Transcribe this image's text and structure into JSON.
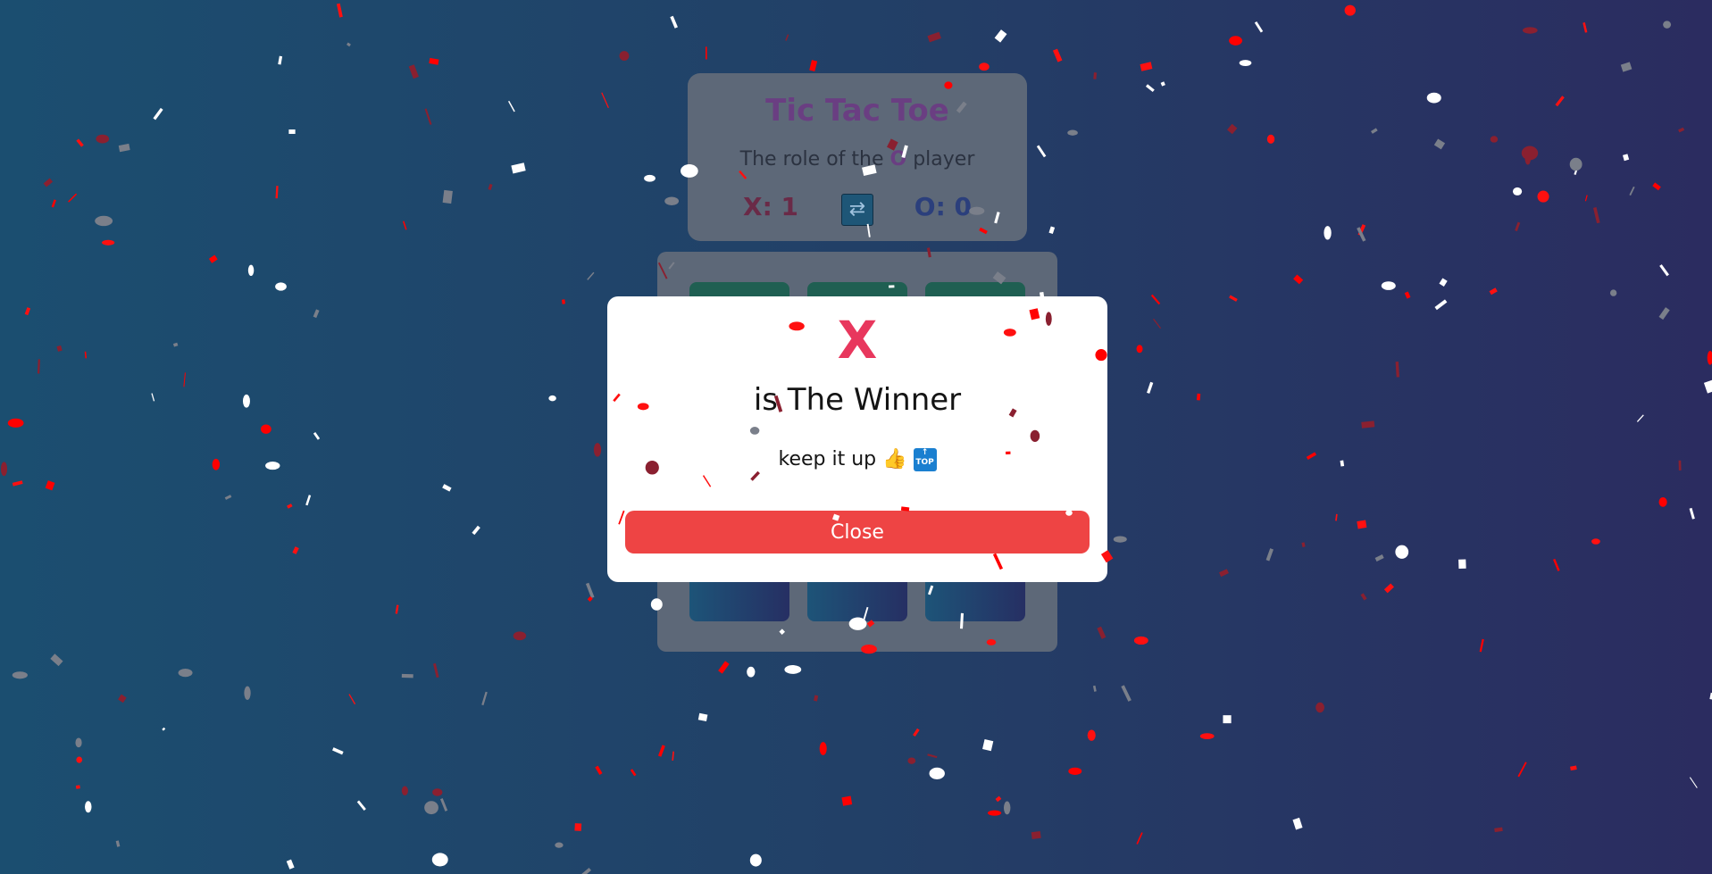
{
  "app": {
    "title": "Tic Tac Toe",
    "subtitle_prefix": "The role of the",
    "current_player": "O",
    "subtitle_suffix": "player",
    "score_x": "X: 1",
    "score_o": "O: 0",
    "switch_icon": "repeat-icon"
  },
  "modal": {
    "winner": "X",
    "winner_text": "is The Winner",
    "message": "keep it up",
    "emoji_1": "👍",
    "emoji_2_line1": "↑",
    "emoji_2_line2": "TOP",
    "close_label": "Close"
  },
  "colors": {
    "accent_x": "#e8375d",
    "close_button": "#ee4444",
    "panel": "#5d6878",
    "title": "#6a3e82"
  }
}
